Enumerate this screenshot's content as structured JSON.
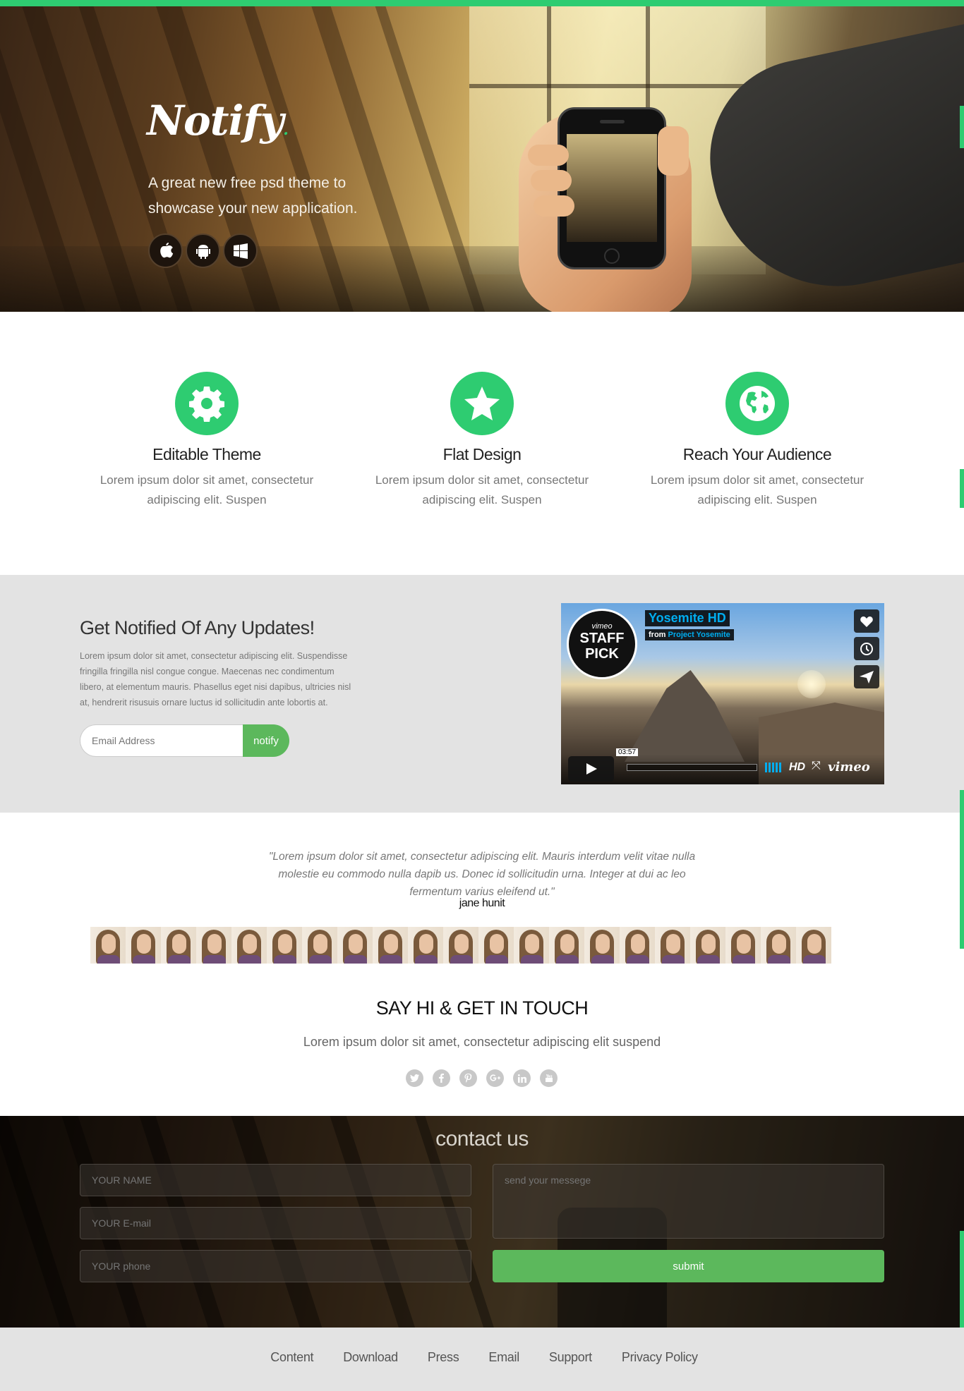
{
  "brand": {
    "logo_text": "Notify",
    "accent_color": "#2ecc71",
    "button_color": "#5cb85c"
  },
  "hero": {
    "tagline": "A great new free psd theme to showcase your new application.",
    "store_icons": [
      "apple-icon",
      "android-icon",
      "windows-icon"
    ]
  },
  "features": [
    {
      "icon": "gear-icon",
      "title": "Editable Theme",
      "text": "Lorem ipsum dolor sit amet, consectetur adipiscing elit. Suspen"
    },
    {
      "icon": "star-icon",
      "title": "Flat Design",
      "text": "Lorem ipsum dolor sit amet, consectetur adipiscing elit. Suspen"
    },
    {
      "icon": "globe-icon",
      "title": "Reach Your Audience",
      "text": "Lorem ipsum dolor sit amet, consectetur adipiscing elit. Suspen"
    }
  ],
  "notify": {
    "title": "Get Notified Of Any Updates!",
    "text": "Lorem ipsum dolor sit amet, consectetur adipiscing elit. Suspendisse fringilla fringilla nisl congue congue. Maecenas nec condimentum libero, at elementum mauris. Phasellus eget nisi dapibus, ultricies nisl at, hendrerit risusuis ornare luctus id sollicitudin ante lobortis at.",
    "email_placeholder": "Email Address",
    "button_label": "notify"
  },
  "video": {
    "badge_brand": "vimeo",
    "badge_line1": "STAFF",
    "badge_line2": "PICK",
    "title": "Yosemite HD",
    "from_prefix": "from",
    "from_name": "Project Yosemite",
    "duration": "03:57",
    "hd_label": "HD",
    "logo": "vimeo"
  },
  "testimonial": {
    "quote": "\"Lorem ipsum dolor sit amet, consectetur adipiscing elit. Mauris interdum velit vitae nulla molestie eu commodo nulla dapib us. Donec id sollicitudin urna. Integer at dui ac leo fermentum varius eleifend ut.\"",
    "author": "jane hunit",
    "avatar_count": 21
  },
  "touch": {
    "title": "SAY HI & GET IN TOUCH",
    "subtitle": "Lorem ipsum dolor sit amet, consectetur adipiscing elit suspend",
    "socials": [
      "twitter-icon",
      "facebook-icon",
      "pinterest-icon",
      "google-plus-icon",
      "linkedin-icon",
      "youtube-icon"
    ]
  },
  "contact": {
    "title": "contact us",
    "name_placeholder": "YOUR NAME",
    "email_placeholder": "YOUR E-mail",
    "phone_placeholder": "YOUR phone",
    "message_placeholder": "send your messege",
    "submit_label": "submit"
  },
  "footer": {
    "links": [
      "Content",
      "Download",
      "Press",
      "Email",
      "Support",
      "Privacy Policy"
    ]
  }
}
